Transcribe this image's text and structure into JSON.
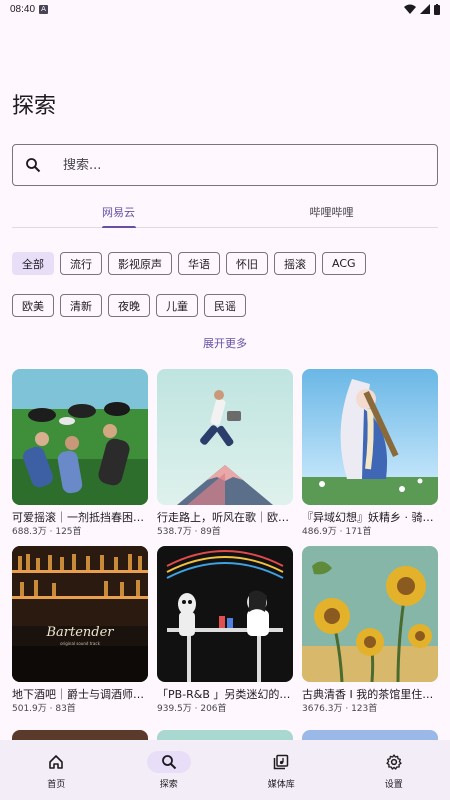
{
  "status_bar": {
    "time": "08:40"
  },
  "page": {
    "title": "探索"
  },
  "search": {
    "placeholder": "搜索..."
  },
  "tabs": [
    {
      "label": "网易云",
      "active": true
    },
    {
      "label": "哔哩哔哩",
      "active": false
    }
  ],
  "chips_row1": [
    "全部",
    "流行",
    "影视原声",
    "华语",
    "怀旧",
    "摇滚",
    "ACG"
  ],
  "chips_row2": [
    "欧美",
    "清新",
    "夜晚",
    "儿童",
    "民谣"
  ],
  "selected_chip": "全部",
  "expand_more": "展开更多",
  "playlists": [
    {
      "title": "可爱摇滚｜一剂抵挡春困的良药",
      "meta": "688.3万 · 125首"
    },
    {
      "title": "行走路上，听风在歌｜欧美民谣",
      "meta": "538.7万 · 89首"
    },
    {
      "title": "『异域幻想』妖精乡 · 骑士之歌",
      "meta": "486.9万 · 171首"
    },
    {
      "title": "地下酒吧｜爵士与调酒师的夜晚",
      "meta": "501.9万 · 83首"
    },
    {
      "title": "「PB-R&B 」另类迷幻的旋律",
      "meta": "939.5万 · 206首"
    },
    {
      "title": "古典清香 I 我的茶馆里住着诗人",
      "meta": "3676.3万 · 123首"
    }
  ],
  "cover_text": {
    "bartender": "Bartender",
    "bartender_sub": "original sound track"
  },
  "bottom_nav": [
    {
      "label": "首页",
      "icon": "home-icon",
      "active": false
    },
    {
      "label": "探索",
      "icon": "search-icon",
      "active": true
    },
    {
      "label": "媒体库",
      "icon": "library-icon",
      "active": false
    },
    {
      "label": "设置",
      "icon": "settings-icon",
      "active": false
    }
  ],
  "colors": {
    "accent": "#6750a4",
    "chip_selected": "#e8def8",
    "background": "#fef7fd",
    "nav_bg": "#f3edf7"
  }
}
